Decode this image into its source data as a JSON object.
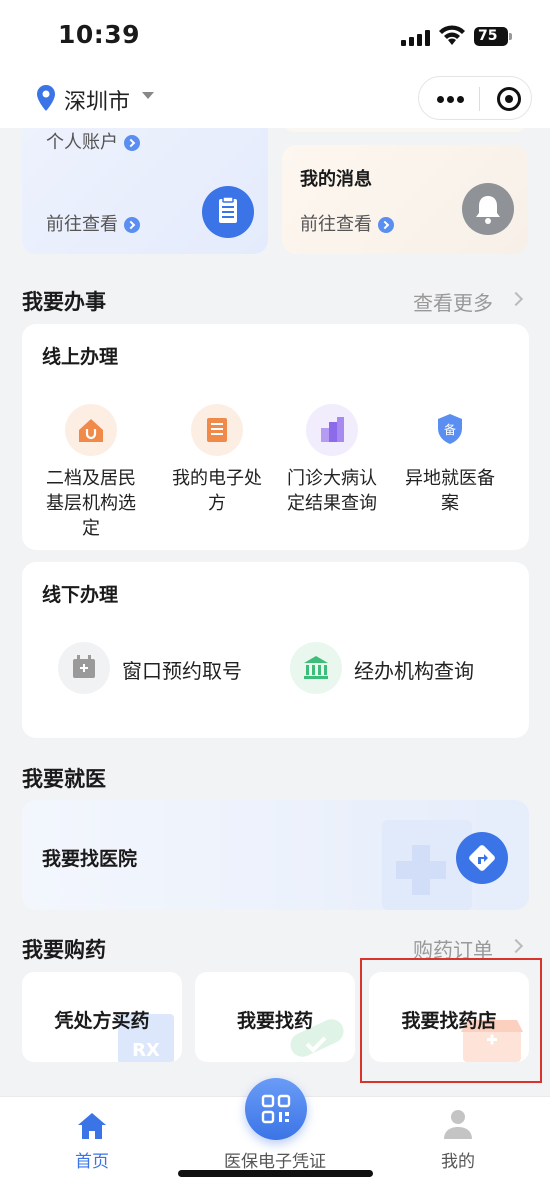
{
  "status_bar": {
    "time": "10:39",
    "battery": "75"
  },
  "header": {
    "city": "深圳市"
  },
  "top_cards": {
    "account": {
      "label": "个人账户",
      "link": "前往查看"
    },
    "message": {
      "title": "我的消息",
      "link": "前往查看"
    }
  },
  "services": {
    "title": "我要办事",
    "more": "查看更多",
    "online": {
      "title": "线上办理",
      "items": [
        {
          "label": "二档及居民基层机构选定",
          "icon": "house-stethoscope-icon"
        },
        {
          "label": "我的电子处方",
          "icon": "prescription-icon"
        },
        {
          "label": "门诊大病认定结果查询",
          "icon": "bar-chart-icon"
        },
        {
          "label": "异地就医备案",
          "icon": "shield-icon"
        }
      ]
    },
    "offline": {
      "title": "线下办理",
      "items": [
        {
          "label": "窗口预约取号",
          "icon": "calendar-icon"
        },
        {
          "label": "经办机构查询",
          "icon": "institution-icon"
        }
      ]
    }
  },
  "doctor": {
    "title": "我要就医",
    "hospital": "我要找医院"
  },
  "medicine": {
    "title": "我要购药",
    "more": "购药订单",
    "items": [
      {
        "label": "凭处方买药"
      },
      {
        "label": "我要找药"
      },
      {
        "label": "我要找药店"
      }
    ]
  },
  "tabbar": {
    "home": "首页",
    "voucher": "医保电子凭证",
    "me": "我的"
  },
  "colors": {
    "accent": "#3b74e6",
    "highlight": "#d9342b",
    "icon_orange": "#f08a4b",
    "icon_purple": "#8c6bea",
    "icon_green": "#3ebd7a"
  }
}
